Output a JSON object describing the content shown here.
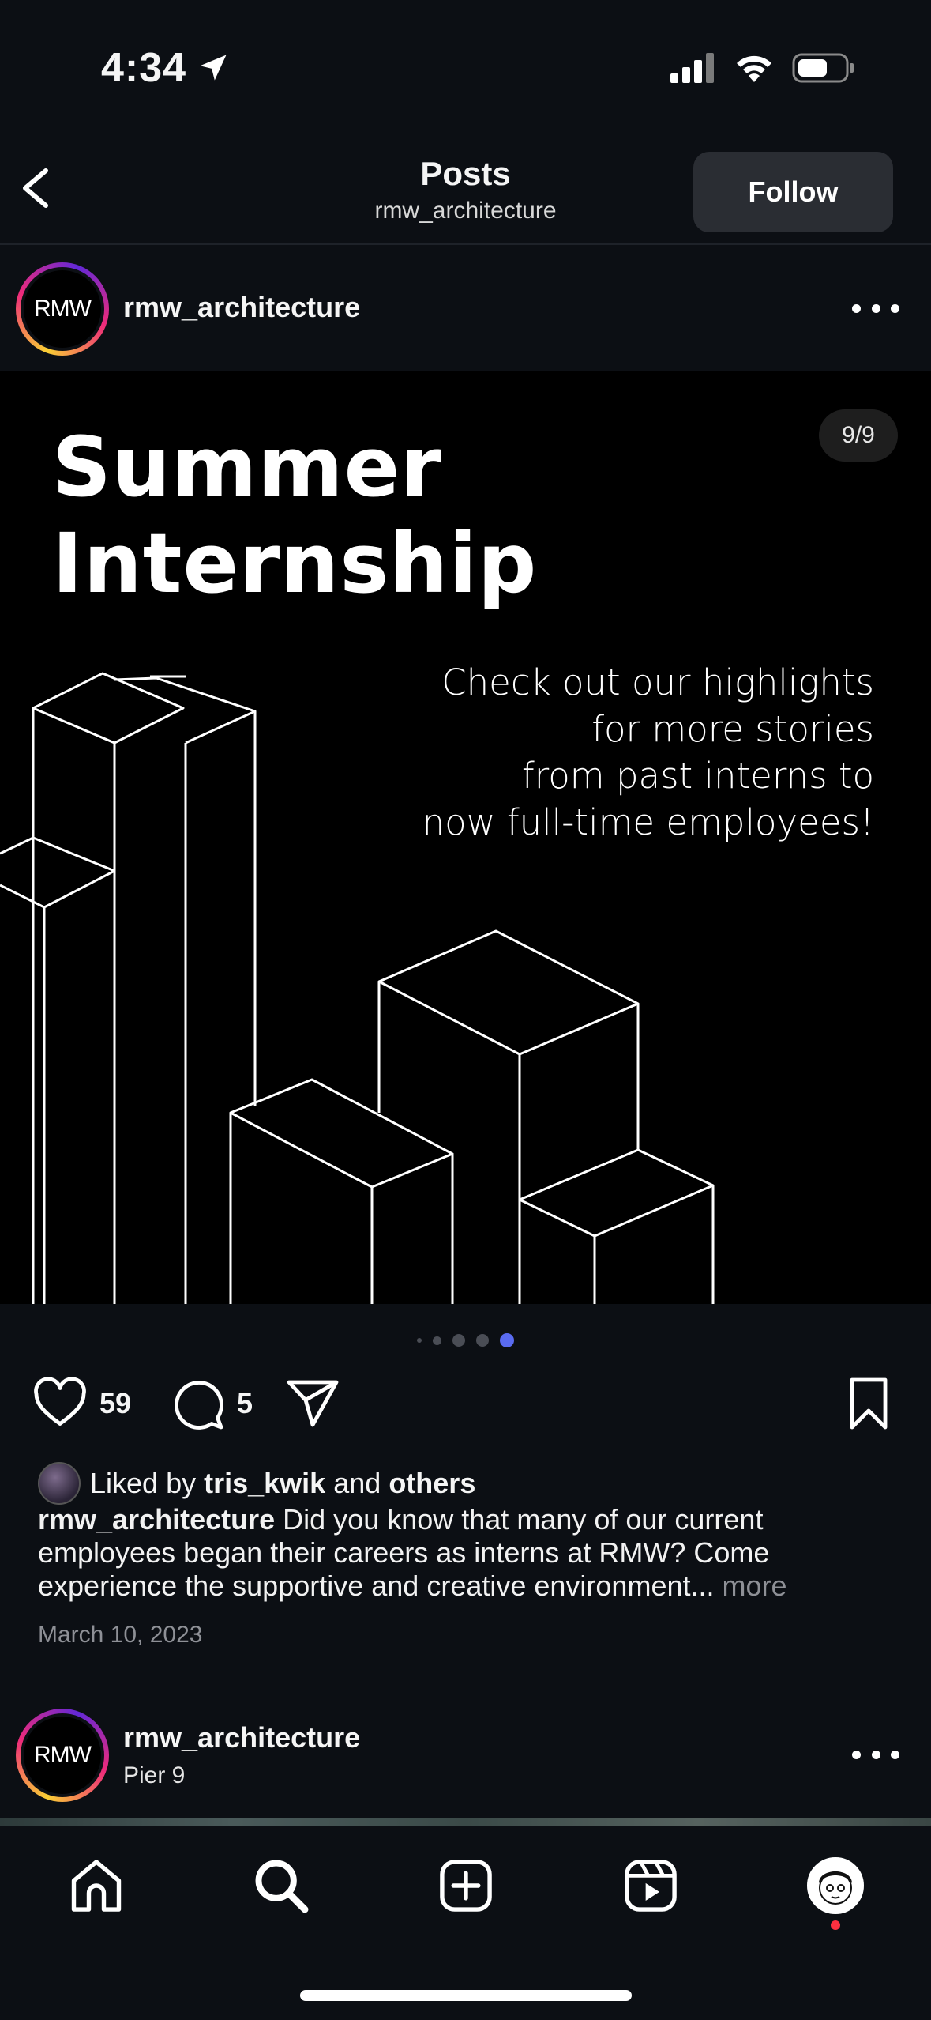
{
  "status_bar": {
    "time": "4:34"
  },
  "header": {
    "title": "Posts",
    "subtitle": "rmw_architecture",
    "follow_label": "Follow"
  },
  "post": {
    "username": "rmw_architecture",
    "avatar_text": "RMW",
    "image": {
      "title_line1": "Summer",
      "title_line2": "Internship",
      "text_lines": [
        "Check out our highlights",
        "for more stories",
        "from past interns to",
        "now full-time employees!"
      ],
      "page_counter": "9/9"
    },
    "carousel": {
      "total_visible": 5,
      "active_index": 4
    },
    "likes_count": "59",
    "comments_count": "5",
    "liked_by": {
      "prefix": "Liked by",
      "user": "tris_kwik",
      "conj": "and",
      "others": "others"
    },
    "caption": {
      "username": "rmw_architecture",
      "text": "Did you know that many of our current employees began their careers as interns at RMW? Come experience the supportive and creative environment...",
      "more": "more"
    },
    "date": "March 10, 2023"
  },
  "next_post": {
    "username": "rmw_architecture",
    "avatar_text": "RMW",
    "location": "Pier 9"
  },
  "nav": {
    "items": [
      "home-icon",
      "search-icon",
      "create-icon",
      "reels-icon",
      "profile-avatar"
    ]
  },
  "colors": {
    "background": "#0c0f14",
    "carousel_active": "#5a6bf0",
    "notification": "#ff3040"
  }
}
